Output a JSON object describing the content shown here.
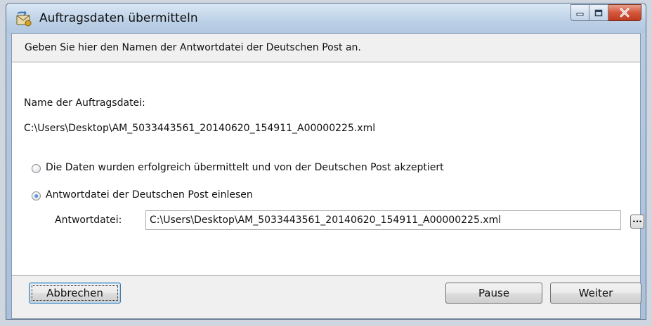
{
  "window": {
    "title": "Auftragsdaten übermitteln",
    "icon": "envelope-icon"
  },
  "caption_buttons": {
    "minimize_icon": "minimize-icon",
    "maximize_icon": "maximize-icon",
    "close_icon": "close-icon",
    "close_color": "#c84a2e"
  },
  "header": {
    "instruction": "Geben Sie hier den Namen der Antwortdatei der Deutschen Post an."
  },
  "order_file": {
    "label": "Name der Auftragsdatei:",
    "path": "C:\\Users\\Desktop\\AM_5033443561_20140620_154911_A00000225.xml"
  },
  "options": [
    {
      "label": "Die Daten wurden erfolgreich übermittelt und von der Deutschen Post akzeptiert",
      "selected": false
    },
    {
      "label": "Antwortdatei der Deutschen Post einlesen",
      "selected": true
    }
  ],
  "response_file": {
    "label": "Antwortdatei:",
    "value": "C:\\Users\\Desktop\\AM_5033443561_20140620_154911_A00000225.xml",
    "browse_label": "..."
  },
  "buttons": {
    "cancel": "Abbrechen",
    "pause": "Pause",
    "next": "Weiter"
  }
}
